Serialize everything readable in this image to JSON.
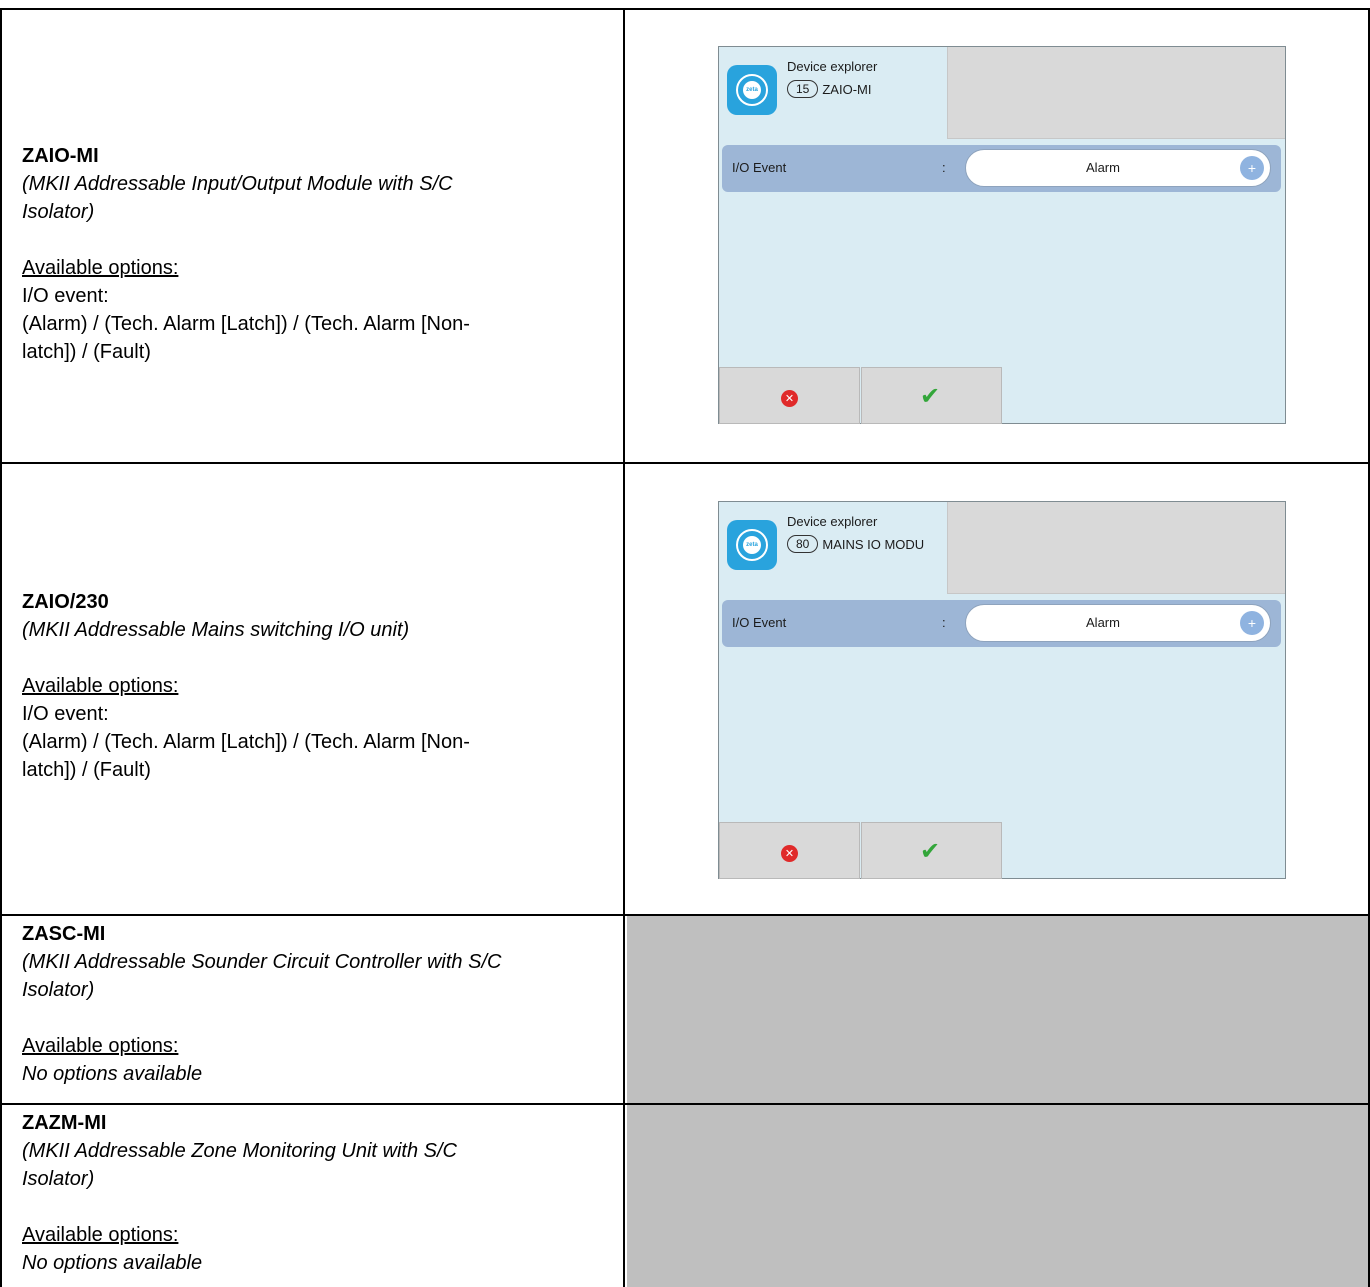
{
  "rows": [
    {
      "name": "ZAIO-MI",
      "subtitle_line1": "(MKII Addressable Input/Output Module with S/C",
      "subtitle_line2": "Isolator)",
      "options_heading": "Available options:",
      "option_label": "I/O event:",
      "options_line1": "(Alarm) / (Tech. Alarm [Latch]) / (Tech. Alarm [Non-",
      "options_line2": "latch]) / (Fault)",
      "screen": {
        "title": "Device explorer",
        "address": "15",
        "device_name": "ZAIO-MI",
        "event_label": "I/O Event",
        "colon": ":",
        "event_value": "Alarm",
        "plus": "+",
        "cancel_glyph": "✕",
        "ok_glyph": "✔"
      }
    },
    {
      "name": "ZAIO/230",
      "subtitle_line1": "(MKII Addressable Mains switching I/O unit)",
      "options_heading": "Available options:",
      "option_label": "I/O event:",
      "options_line1": "(Alarm) / (Tech. Alarm [Latch]) / (Tech. Alarm [Non-",
      "options_line2": "latch]) / (Fault)",
      "screen": {
        "title": "Device explorer",
        "address": "80",
        "device_name": "MAINS IO MODU",
        "event_label": "I/O Event",
        "colon": ":",
        "event_value": "Alarm",
        "plus": "+",
        "cancel_glyph": "✕",
        "ok_glyph": "✔"
      }
    },
    {
      "name": "ZASC-MI",
      "subtitle_line1": "(MKII Addressable Sounder Circuit Controller with S/C",
      "subtitle_line2": "Isolator)",
      "options_heading": "Available options:",
      "no_options": "No options available"
    },
    {
      "name": "ZAZM-MI",
      "subtitle_line1": "(MKII Addressable Zone Monitoring Unit with S/C",
      "subtitle_line2": "Isolator)",
      "options_heading": "Available options:",
      "no_options": "No options available"
    }
  ],
  "colors": {
    "screen_bg": "#daecf3",
    "event_bar": "#9db6d6",
    "grey_cell": "#bfbfbf",
    "app_icon": "#29a3dd",
    "cancel_red": "#e02a2a",
    "ok_green": "#33a63a"
  }
}
